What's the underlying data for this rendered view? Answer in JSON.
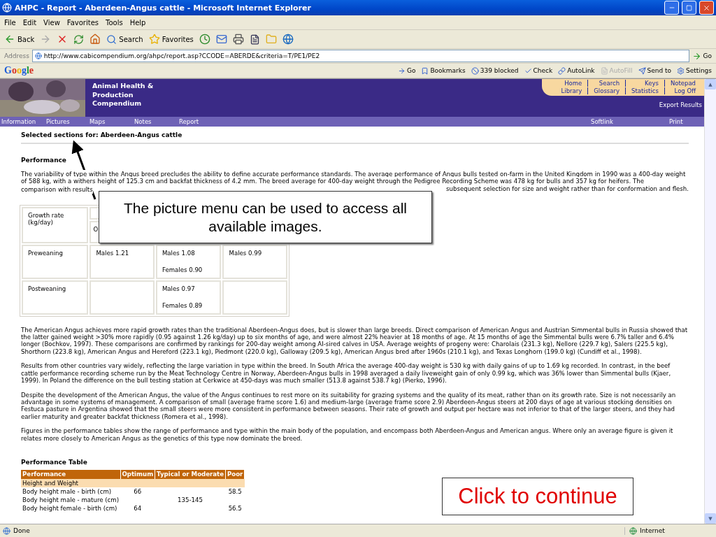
{
  "window": {
    "title": "AHPC - Report - Aberdeen-Angus cattle - Microsoft Internet Explorer"
  },
  "menu": [
    "File",
    "Edit",
    "View",
    "Favorites",
    "Tools",
    "Help"
  ],
  "toolbar": {
    "back": "Back",
    "search": "Search",
    "favorites": "Favorites"
  },
  "address": {
    "label": "Address",
    "url": "http://www.cabicompendium.org/ahpc/report.asp?CCODE=ABERDE&criteria=T/PE1/PE2",
    "go": "Go"
  },
  "google_bar": {
    "logo": "Google",
    "items": [
      {
        "label": "Go",
        "disabled": false
      },
      {
        "label": "Bookmarks",
        "disabled": false
      },
      {
        "label": "339 blocked",
        "disabled": false
      },
      {
        "label": "Check",
        "disabled": false
      },
      {
        "label": "AutoLink",
        "disabled": false
      },
      {
        "label": "AutoFill",
        "disabled": true
      },
      {
        "label": "Send to",
        "disabled": false
      },
      {
        "label": "Settings",
        "disabled": false
      }
    ]
  },
  "site": {
    "title": [
      "Animal Health &",
      "Production",
      "Compendium"
    ],
    "links_top": [
      "Home",
      "Search",
      "Keys",
      "Notepad"
    ],
    "links_bottom": [
      "Library",
      "Glossary",
      "Statistics",
      "Log Off"
    ],
    "export": "Export Results",
    "nav": [
      "Information",
      "Pictures",
      "Maps",
      "Notes",
      "Report"
    ],
    "nav_right": [
      "Softlink",
      "Print"
    ]
  },
  "content": {
    "heading": "Selected sections for: Aberdeen-Angus cattle",
    "section": "Performance",
    "intro": "The variability of type within the Angus breed precludes the ability to define accurate performance standards. The average performance of Angus bulls tested on-farm in the United Kingdom in 1990 was a 400-day weight of 588 kg, with a withers height of 125.3 cm and backfat thickness of 4.2 mm. The breed average for 400-day weight through the Pedigree Recording Scheme was 478 kg for bulls and 357 kg for heifers. The",
    "intro_end_left": "comparison with results",
    "intro_end_right": "subsequent selection for size and weight rather than for conformation and flesh.",
    "growth_table": {
      "header": "Growth rate (kg/day)",
      "subheader": "O",
      "rows": [
        {
          "label": "Preweaning",
          "cells": [
            [
              "Males 1.21"
            ],
            [
              "Males 1.08",
              "Females 0.90"
            ],
            [
              "Males 0.99"
            ]
          ]
        },
        {
          "label": "Postweaning",
          "cells": [
            [],
            [
              "Males 0.97",
              "Females 0.89"
            ],
            []
          ]
        }
      ]
    },
    "paragraphs": [
      "The American Angus achieves more rapid growth rates than the traditional Aberdeen-Angus does, but is slower than large breeds. Direct comparison of American Angus and Austrian Simmental bulls in Russia showed that the latter gained weight >30% more rapidly (0.95 against 1.26 kg/day) up to six months of age, and were almost 22% heavier at 18 months of age. At 15 months of age the Simmental bulls were 6.7% taller and 6.4% longer (Bochkov, 1997). These comparisons are confirmed by rankings for 200-day weight among AI-sired calves in USA. Average weights of progeny were: Charolais (231.3 kg), Nellore (229.7 kg), Salers (225.5 kg), Shorthorn (223.8 kg), American Angus and Hereford (223.1 kg), Piedmont (220.0 kg), Galloway (209.5 kg), American Angus bred after 1960s (210.1 kg), and Texas Longhorn (199.0 kg) (Cundiff et al., 1998).",
      "Results from other countries vary widely, reflecting the large variation in type within the breed. In South Africa the average 400-day weight is 530 kg with daily gains of up to 1.69 kg recorded. In contrast, in the beef cattle performance recording scheme run by the Meat Technology Centre in Norway, Aberdeen-Angus bulls in 1998 averaged a daily liveweight gain of only 0.99 kg, which was 36% lower than Simmental bulls (Kjaer, 1999). In Poland the difference on the bull testing station at Cerkwice at 450-days was much smaller (513.8 against 538.7 kg) (Pierko, 1996).",
      "Despite the development of the American Angus, the value of the Angus continues to rest more on its suitability for grazing systems and the quality of its meat, rather than on its growth rate. Size is not necessarily an advantage in some systems of management. A comparison of small (average frame score 1.6) and medium-large (average frame score 2.9) Aberdeen-Angus steers at 200 days of age at various stocking densities on Festuca pasture in Argentina showed that the small steers were more consistent in performance between seasons. Their rate of growth and output per hectare was not inferior to that of the larger steers, and they had earlier maturity and greater backfat thickness (Romera et al., 1998).",
      "Figures in the performance tables show the range of performance and type within the main body of the population, and encompass both Aberdeen-Angus and American angus. Where only an average figure is given it relates more closely to American Angus as the genetics of this type now dominate the breed."
    ],
    "table_title": "Performance Table",
    "perf_table": {
      "columns": [
        "Performance",
        "Optimum",
        "Typical or Moderate",
        "Poor"
      ],
      "rows": [
        {
          "kind": "group",
          "cells": [
            "Height and Weight"
          ]
        },
        {
          "kind": "row",
          "cells": [
            "Body height male - birth (cm)",
            "66",
            "",
            "58.5"
          ]
        },
        {
          "kind": "row",
          "cells": [
            "Body height male - mature (cm)",
            "",
            "135-145",
            ""
          ]
        },
        {
          "kind": "row",
          "cells": [
            "Body height female - birth (cm)",
            "64",
            "",
            "56.5"
          ]
        }
      ]
    }
  },
  "callout": "The picture menu can be used to access all available images.",
  "continue_button": "Click to continue",
  "scrollbar": {
    "up": "▲",
    "down": "▼"
  },
  "status_bar": {
    "text": "Done",
    "zone": "Internet"
  }
}
